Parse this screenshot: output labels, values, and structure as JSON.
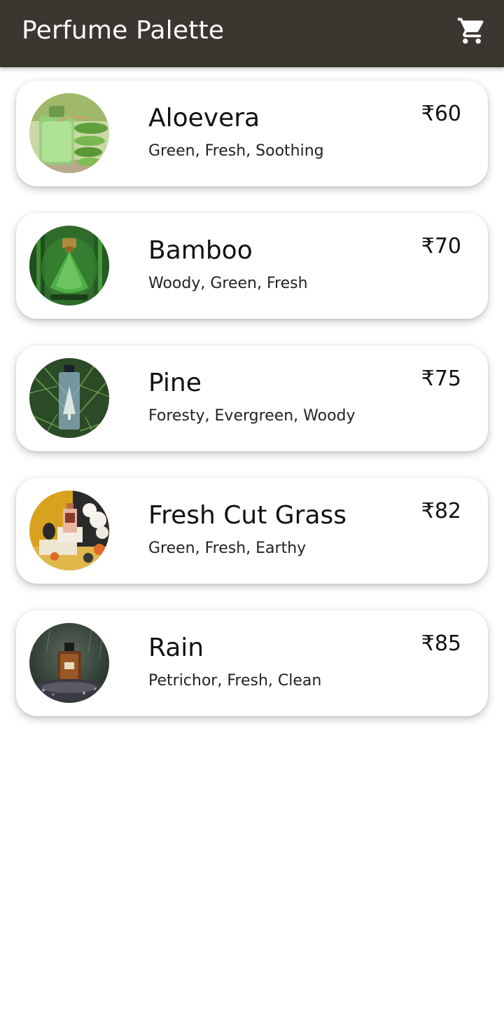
{
  "app_bar": {
    "title": "Perfume Palette",
    "background": "#3b3730",
    "cart_icon": "shopping-cart-icon"
  },
  "products": [
    {
      "name": "Aloevera",
      "notes": "Green, Fresh, Soothing",
      "price": "₹60",
      "image": "aloevera-perfume-photo"
    },
    {
      "name": "Bamboo",
      "notes": "Woody, Green, Fresh",
      "price": "₹70",
      "image": "bamboo-perfume-photo"
    },
    {
      "name": "Pine",
      "notes": "Foresty, Evergreen, Woody",
      "price": "₹75",
      "image": "pine-perfume-photo"
    },
    {
      "name": "Fresh Cut Grass",
      "notes": "Green, Fresh, Earthy",
      "price": "₹82",
      "image": "fresh-cut-grass-perfume-photo"
    },
    {
      "name": "Rain",
      "notes": "Petrichor, Fresh, Clean",
      "price": "₹85",
      "image": "rain-perfume-photo"
    }
  ]
}
